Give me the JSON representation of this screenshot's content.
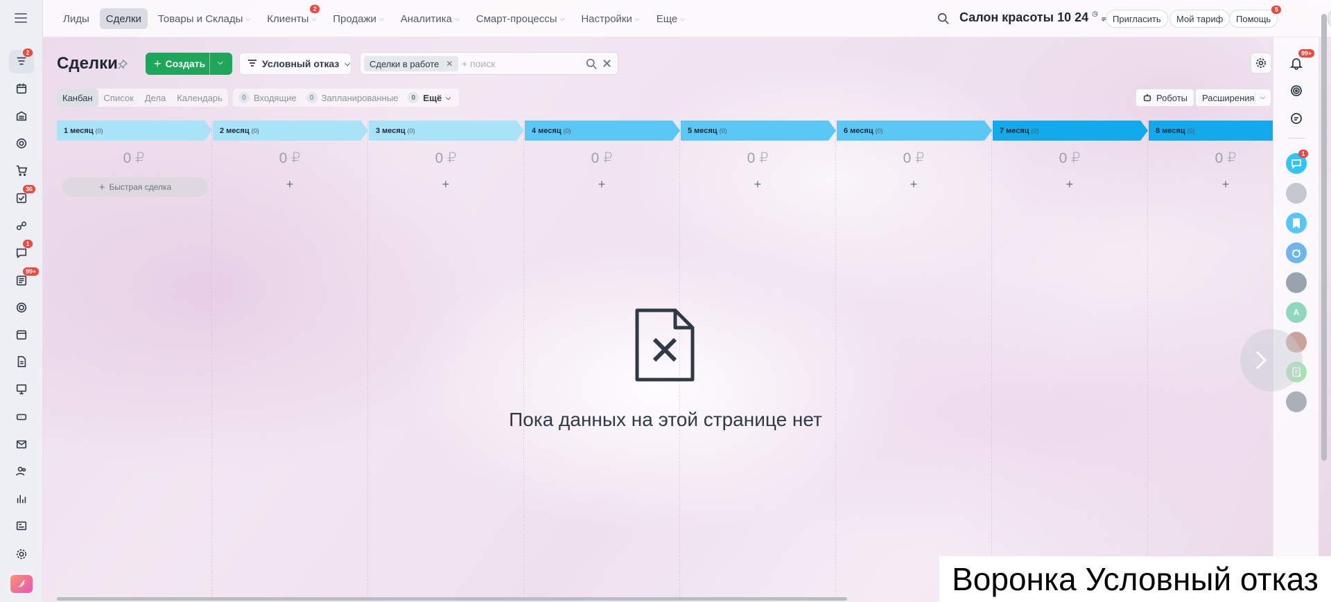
{
  "left_rail": {
    "items": [
      {
        "icon": "crm-funnel-icon",
        "badge": "2",
        "active": true
      },
      {
        "icon": "tasks-calendar-icon",
        "badge": ""
      },
      {
        "icon": "warehouse-icon",
        "badge": ""
      },
      {
        "icon": "target-icon",
        "badge": ""
      },
      {
        "icon": "cart-icon",
        "badge": ""
      },
      {
        "icon": "checklist-icon",
        "badge": "36"
      },
      {
        "icon": "automation-icon",
        "badge": ""
      },
      {
        "icon": "chat-icon",
        "badge": "1"
      },
      {
        "icon": "feed-icon",
        "badge": "99+"
      },
      {
        "icon": "sites-icon",
        "badge": ""
      },
      {
        "icon": "calendar-icon",
        "badge": ""
      },
      {
        "icon": "documents-icon",
        "badge": ""
      },
      {
        "icon": "presentation-icon",
        "badge": ""
      },
      {
        "icon": "storage-icon",
        "badge": ""
      },
      {
        "icon": "mail-icon",
        "badge": ""
      },
      {
        "icon": "team-icon",
        "badge": ""
      },
      {
        "icon": "analytics-icon",
        "badge": ""
      },
      {
        "icon": "contact-card-icon",
        "badge": ""
      },
      {
        "icon": "gear-icon",
        "badge": ""
      }
    ]
  },
  "top_nav": {
    "items": [
      {
        "label": "Лиды",
        "chevron": false,
        "badge": ""
      },
      {
        "label": "Сделки",
        "chevron": false,
        "badge": "",
        "active": true
      },
      {
        "label": "Товары и Склады",
        "chevron": true,
        "badge": ""
      },
      {
        "label": "Клиенты",
        "chevron": true,
        "badge": "2"
      },
      {
        "label": "Продажи",
        "chevron": true,
        "badge": ""
      },
      {
        "label": "Аналитика",
        "chevron": true,
        "badge": ""
      },
      {
        "label": "Смарт-процессы",
        "chevron": true,
        "badge": ""
      },
      {
        "label": "Настройки",
        "chevron": true,
        "badge": ""
      },
      {
        "label": "Еще",
        "chevron": true,
        "badge": ""
      }
    ],
    "company": "Салон красоты",
    "time": "10 24",
    "invite_label": "Пригласить",
    "plan_label": "Мой тариф",
    "help_label": "Помощь",
    "help_badge": "5"
  },
  "toolbar": {
    "title": "Сделки",
    "create_label": "Создать",
    "funnel_label": "Условный отказ",
    "filter_chip": "Сделки в работе",
    "search_placeholder": "+ поиск"
  },
  "views": {
    "tabs": [
      "Канбан",
      "Список",
      "Дела",
      "Календарь"
    ],
    "active": "Канбан",
    "counters": [
      {
        "num": "0",
        "label": "Входящие"
      },
      {
        "num": "0",
        "label": "Запланированные"
      },
      {
        "num": "0",
        "label": "Ещё"
      }
    ],
    "robots_label": "Роботы",
    "extensions_label": "Расширения"
  },
  "kanban": {
    "quick_deal_label": "Быстрая сделка",
    "columns": [
      {
        "name": "1 месяц",
        "count": "(0)",
        "sum": "0 ₽",
        "color": "#a8e3f7"
      },
      {
        "name": "2 месяц",
        "count": "(0)",
        "sum": "0 ₽",
        "color": "#a8e3f7"
      },
      {
        "name": "3 месяц",
        "count": "(0)",
        "sum": "0 ₽",
        "color": "#a8e3f7"
      },
      {
        "name": "4 месяц",
        "count": "(0)",
        "sum": "0 ₽",
        "color": "#5bc7f4"
      },
      {
        "name": "5 месяц",
        "count": "(0)",
        "sum": "0 ₽",
        "color": "#5bc7f4"
      },
      {
        "name": "6 месяц",
        "count": "(0)",
        "sum": "0 ₽",
        "color": "#5bc7f4"
      },
      {
        "name": "7 месяц",
        "count": "(0)",
        "sum": "0 ₽",
        "color": "#12aaea"
      },
      {
        "name": "8 месяц",
        "count": "(0)",
        "sum": "0 ₽",
        "color": "#12aaea"
      }
    ]
  },
  "empty_state": {
    "message": "Пока данных на этой странице нет",
    "icon": "file-error-icon"
  },
  "right_panel": {
    "notifications_badge": "99+",
    "chat_badge": "1",
    "items": [
      "bell-icon",
      "copilot-icon",
      "chat-search-icon",
      "messenger-icon",
      "avatar-group",
      "bookmark-icon",
      "dog-avatar",
      "man-avatar",
      "letter-avatar",
      "woman-avatar",
      "notes-icon",
      "man2-avatar"
    ],
    "letter_avatar": "A"
  },
  "caption": "Воронка Условный отказ"
}
